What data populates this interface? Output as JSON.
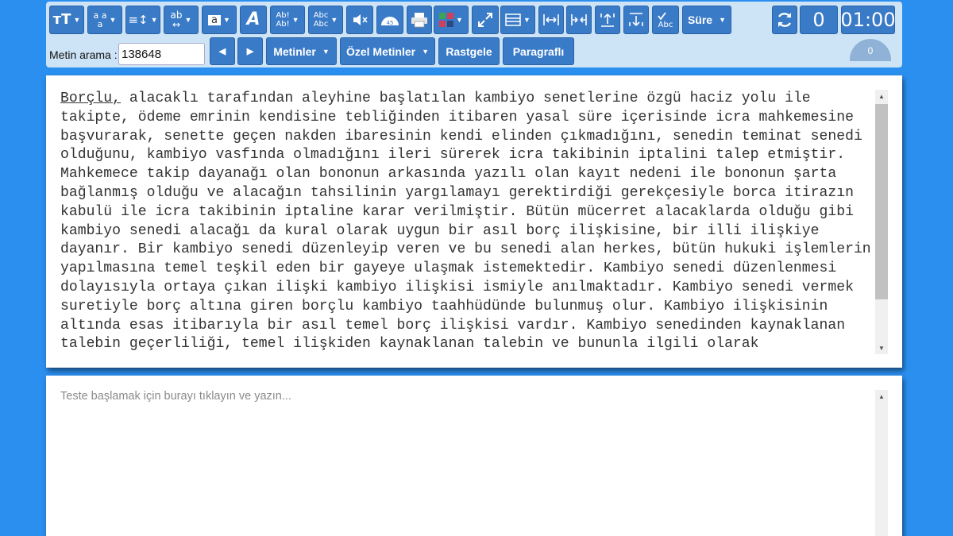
{
  "toolbar": {
    "icons": [
      {
        "name": "font-size-icon",
        "glyph": "тT",
        "caret": true
      },
      {
        "name": "letter-spacing-icon",
        "glyph": "a a\na",
        "caret": true
      },
      {
        "name": "line-spacing-icon",
        "glyph": "≡↕",
        "caret": true
      },
      {
        "name": "word-spacing-icon",
        "glyph": "ab\n↔",
        "caret": true
      },
      {
        "name": "font-color-icon",
        "glyph": "a",
        "caret": true
      },
      {
        "name": "font-style-icon",
        "glyph": "A",
        "caret": false
      },
      {
        "name": "capitalize-icon",
        "glyph": "Ab!\nAb!",
        "caret": true
      },
      {
        "name": "case-icon",
        "glyph": "Abc\nAbc",
        "caret": true
      },
      {
        "name": "mute-icon",
        "glyph": "◀×",
        "caret": false
      },
      {
        "name": "speed-gauge-icon",
        "glyph": "45",
        "caret": false
      },
      {
        "name": "print-icon",
        "glyph": "▤",
        "caret": false
      },
      {
        "name": "color-palette-icon",
        "glyph": "▦",
        "caret": true
      },
      {
        "name": "fullscreen-icon",
        "glyph": "⤢",
        "caret": false
      },
      {
        "name": "layout-icon",
        "glyph": "☰",
        "caret": true
      },
      {
        "name": "expand-width-icon",
        "glyph": "↔",
        "caret": false
      },
      {
        "name": "shrink-width-icon",
        "glyph": "→←",
        "caret": false
      },
      {
        "name": "move-up-icon",
        "glyph": "↥",
        "caret": false
      },
      {
        "name": "move-down-icon",
        "glyph": "↧",
        "caret": false
      },
      {
        "name": "spellcheck-icon",
        "glyph": "Abc",
        "caret": false
      }
    ],
    "duration_label": "Süre",
    "counter_value": "0",
    "timer": "01:00",
    "gauge_value": "0"
  },
  "search": {
    "label": "Metin arama :",
    "value": "138648"
  },
  "nav_buttons": {
    "prev": "◀",
    "next": "▶",
    "texts": "Metinler",
    "custom_texts": "Özel Metinler",
    "random": "Rastgele",
    "paragraphs": "Paragraflı"
  },
  "reading": {
    "first_word": "Borçlu,",
    "body": " alacaklı tarafından aleyhine başlatılan kambiyo senetlerine özgü haciz yolu ile takipte, ödeme emrinin kendisine tebliğinden itibaren yasal süre içerisinde icra mahkemesine başvurarak, senette geçen nakden ibaresinin kendi elinden çıkmadığını, senedin teminat senedi olduğunu, kambiyo vasfında olmadığını ileri sürerek icra takibinin iptalini talep etmiştir. Mahkemece takip dayanağı olan bononun arkasında yazılı olan kayıt nedeni ile bononun şarta bağlanmış olduğu ve alacağın tahsilinin yargılamayı gerektirdiği gerekçesiyle borca itirazın kabulü ile icra takibinin iptaline karar verilmiştir. Bütün mücerret alacaklarda olduğu gibi kambiyo senedi alacağı da kural olarak uygun bir asıl borç ilişkisine, bir illi ilişkiye dayanır. Bir kambiyo senedi düzenleyip veren ve bu senedi alan herkes, bütün hukuki işlemlerin yapılmasına temel teşkil eden bir gayeye ulaşmak istemektedir. Kambiyo senedi düzenlenmesi dolayısıyla ortaya çıkan ilişki kambiyo ilişkisi ismiyle anılmaktadır. Kambiyo senedi vermek suretiyle borç altına giren borçlu kambiyo taahhüdünde bulunmuş olur. Kambiyo ilişkisinin altında esas itibarıyla bir asıl temel borç ilişkisi vardır. Kambiyo senedinden kaynaklanan talebin geçerliliği, temel ilişkiden kaynaklanan talebin ve bununla ilgili olarak"
  },
  "typing": {
    "placeholder": "Teste başlamak için burayı tıklayın ve yazın..."
  }
}
